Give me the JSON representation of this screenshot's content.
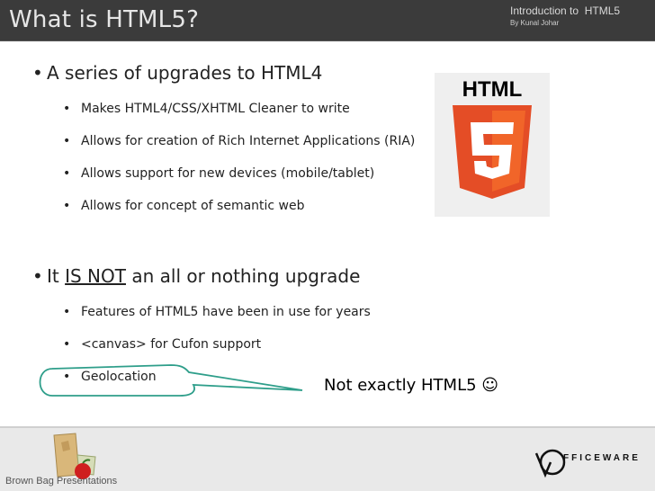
{
  "header": {
    "title": "What is HTML5?",
    "course": "Introduction to  HTML5",
    "author": "By Kunal Johar"
  },
  "bullet_glyph": "•",
  "sections": [
    {
      "heading": "A series of upgrades to HTML4",
      "items": [
        "Makes HTML4/CSS/XHTML Cleaner to write",
        "Allows for creation of Rich Internet Applications (RIA)",
        "Allows support for new devices (mobile/tablet)",
        "Allows for concept of semantic web"
      ]
    },
    {
      "heading_pre": "It ",
      "heading_emph": "IS NOT",
      "heading_post": " an all or nothing upgrade",
      "items": [
        "Features of HTML5 have been in use for years",
        "<canvas> for Cufon support",
        "Geolocation"
      ]
    }
  ],
  "logo": {
    "text": "HTML",
    "number": "5",
    "colors": {
      "shield": "#e44d26",
      "shield_light": "#f16529"
    }
  },
  "callout": {
    "text": "Not exactly HTML5 ☺",
    "stroke": "#2e9e8a"
  },
  "footer": {
    "label": "Brown Bag Presentations",
    "brand": "FFICEWARE"
  },
  "colors": {
    "header_bg": "#3b3b3b",
    "footer_bg": "#e9e9e9"
  }
}
